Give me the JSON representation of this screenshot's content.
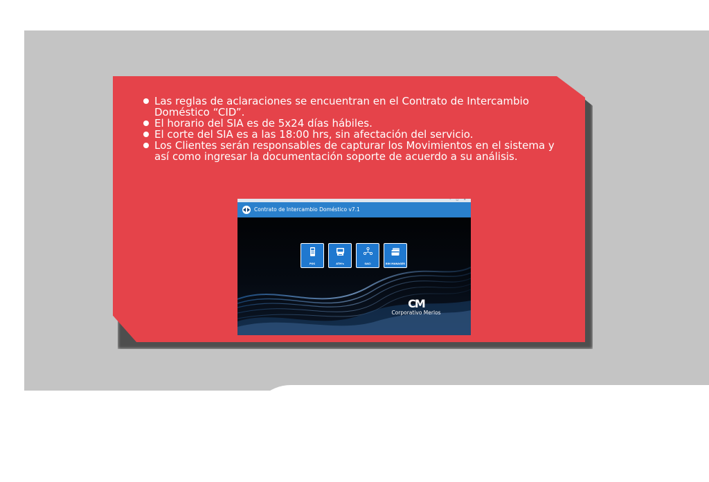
{
  "slide": {
    "bullets": [
      "Las reglas de aclaraciones se encuentran en el Contrato de Intercambio Doméstico “CID”.",
      "El horario del SIA es de 5x24 días hábiles.",
      "El corte del SIA es a las 18:00 hrs, sin afectación del servicio.",
      "Los Clientes serán responsables de capturar los Movimientos en el sistema y  así como ingresar la documentación soporte de acuerdo a su análisis."
    ]
  },
  "app": {
    "header_title": "Contrato de Intercambio Doméstico v7.1",
    "window_controls": "– □ ✕",
    "tiles": [
      {
        "label": "POS",
        "icon": "pos-terminal-icon"
      },
      {
        "label": "ATM's",
        "icon": "atm-icon"
      },
      {
        "label": "SACI",
        "icon": "network-people-icon"
      },
      {
        "label": "BIN MANAGER",
        "icon": "cards-icon"
      }
    ],
    "brand_mark": "CM",
    "brand_name": "Corporativo Merlos"
  },
  "colors": {
    "background_band": "#c4c4c4",
    "card_red": "#e5434a",
    "app_blue": "#2a80cc",
    "tile_blue": "#1f78cf"
  }
}
